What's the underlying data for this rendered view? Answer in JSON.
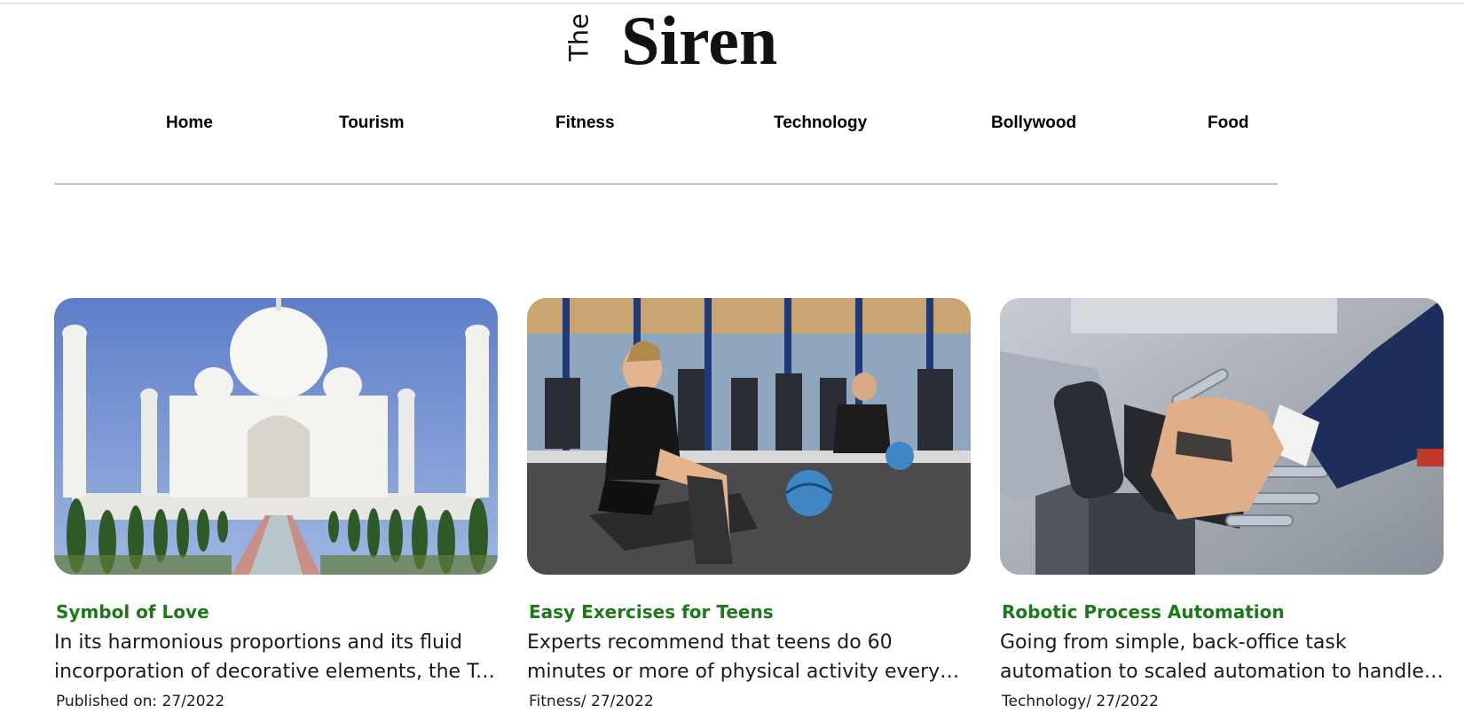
{
  "brand": {
    "prefix": "The",
    "name": "Siren"
  },
  "nav": {
    "items": [
      {
        "label": "Home"
      },
      {
        "label": "Tourism"
      },
      {
        "label": "Fitness"
      },
      {
        "label": "Technology"
      },
      {
        "label": "Bollywood"
      },
      {
        "label": "Food"
      }
    ]
  },
  "articles": [
    {
      "title": "Symbol of Love",
      "description": "In its harmonious proportions and its fluid incorporation of decorative elements, the Taj Mahal is distinguished as the finest example of Mughal architecture.",
      "meta": "Published on: 27/2022",
      "image": "taj-mahal-photo"
    },
    {
      "title": "Easy Exercises for Teens",
      "description": "Experts recommend that teens do 60 minutes or more of physical activity every day.",
      "meta": "Fitness/ 27/2022",
      "image": "gym-stretching-photo"
    },
    {
      "title": "Robotic Process Automation",
      "description": "Going from simple, back-office task automation to scaled automation to handle complex processes.",
      "meta": "Technology/ 27/2022",
      "image": "robot-hand-handshake-photo"
    }
  ],
  "colors": {
    "title_green": "#1a7a16",
    "divider": "#8c8c8c"
  }
}
